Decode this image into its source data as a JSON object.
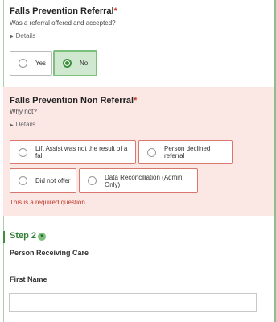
{
  "q1": {
    "title": "Falls Prevention Referral",
    "required_mark": "*",
    "subtitle": "Was a referral offered and accepted?",
    "details": "Details",
    "options": [
      "Yes",
      "No"
    ],
    "selected": "No"
  },
  "q2": {
    "title": "Falls Prevention Non Referral",
    "required_mark": "*",
    "subtitle": "Why not?",
    "details": "Details",
    "options": [
      "Lift Assist was not the result of a fall",
      "Person declined referral",
      "Did not offer",
      "Data Reconciliation (Admin Only)"
    ],
    "error": "This is a required question."
  },
  "step": {
    "title": "Step 2"
  },
  "section": {
    "title": "Person Receiving Care"
  },
  "first_name": {
    "label": "First Name",
    "value": ""
  },
  "colors": {
    "accent_green": "#3d8f3d",
    "selected_bg": "#cfe8cf",
    "error_red": "#c0392b",
    "error_bg": "#fbe7e4"
  }
}
